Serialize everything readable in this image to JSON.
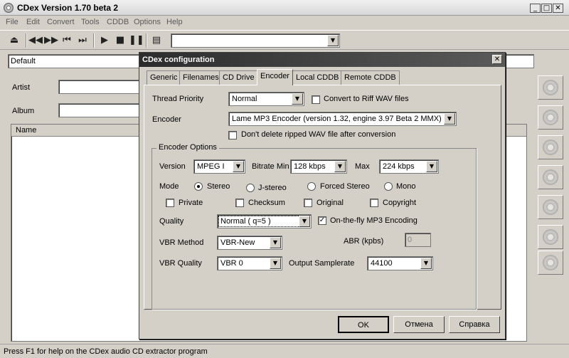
{
  "window": {
    "title": "CDex Version 1.70 beta 2"
  },
  "menu": [
    "File",
    "Edit",
    "Convert",
    "Tools",
    "CDDB",
    "Options",
    "Help"
  ],
  "main": {
    "profile": "Default",
    "artist_label": "Artist",
    "album_label": "Album",
    "name_header": "Name"
  },
  "status": "Press F1 for help on the CDex audio CD extractor program",
  "dialog": {
    "title": "CDex configuration",
    "tabs": [
      "Generic",
      "Filenames",
      "CD Drive",
      "Encoder",
      "Local CDDB",
      "Remote CDDB"
    ],
    "active_tab": "Encoder",
    "thread_priority_label": "Thread Priority",
    "thread_priority": "Normal",
    "riff_label": "Convert to Riff WAV files",
    "encoder_label": "Encoder",
    "encoder": "Lame MP3 Encoder (version 1.32, engine 3.97 Beta 2 MMX)",
    "dont_delete_label": "Don't delete ripped WAV file after conversion",
    "group_title": "Encoder Options",
    "version_label": "Version",
    "version": "MPEG I",
    "bitrate_min_label": "Bitrate Min",
    "bitrate_min": "128 kbps",
    "max_label": "Max",
    "max": "224 kbps",
    "mode_label": "Mode",
    "modes": [
      "Stereo",
      "J-stereo",
      "Forced Stereo",
      "Mono"
    ],
    "private_label": "Private",
    "checksum_label": "Checksum",
    "original_label": "Original",
    "copyright_label": "Copyright",
    "quality_label": "Quality",
    "quality": "Normal ( q=5 )",
    "onthefly_label": "On-the-fly MP3 Encoding",
    "vbr_method_label": "VBR Method",
    "vbr_method": "VBR-New",
    "abr_label": "ABR (kpbs)",
    "abr_value": "0",
    "vbr_quality_label": "VBR Quality",
    "vbr_quality": "VBR 0",
    "samplerate_label": "Output Samplerate",
    "samplerate": "44100",
    "ok": "OK",
    "cancel": "Отмена",
    "help": "Справка"
  }
}
